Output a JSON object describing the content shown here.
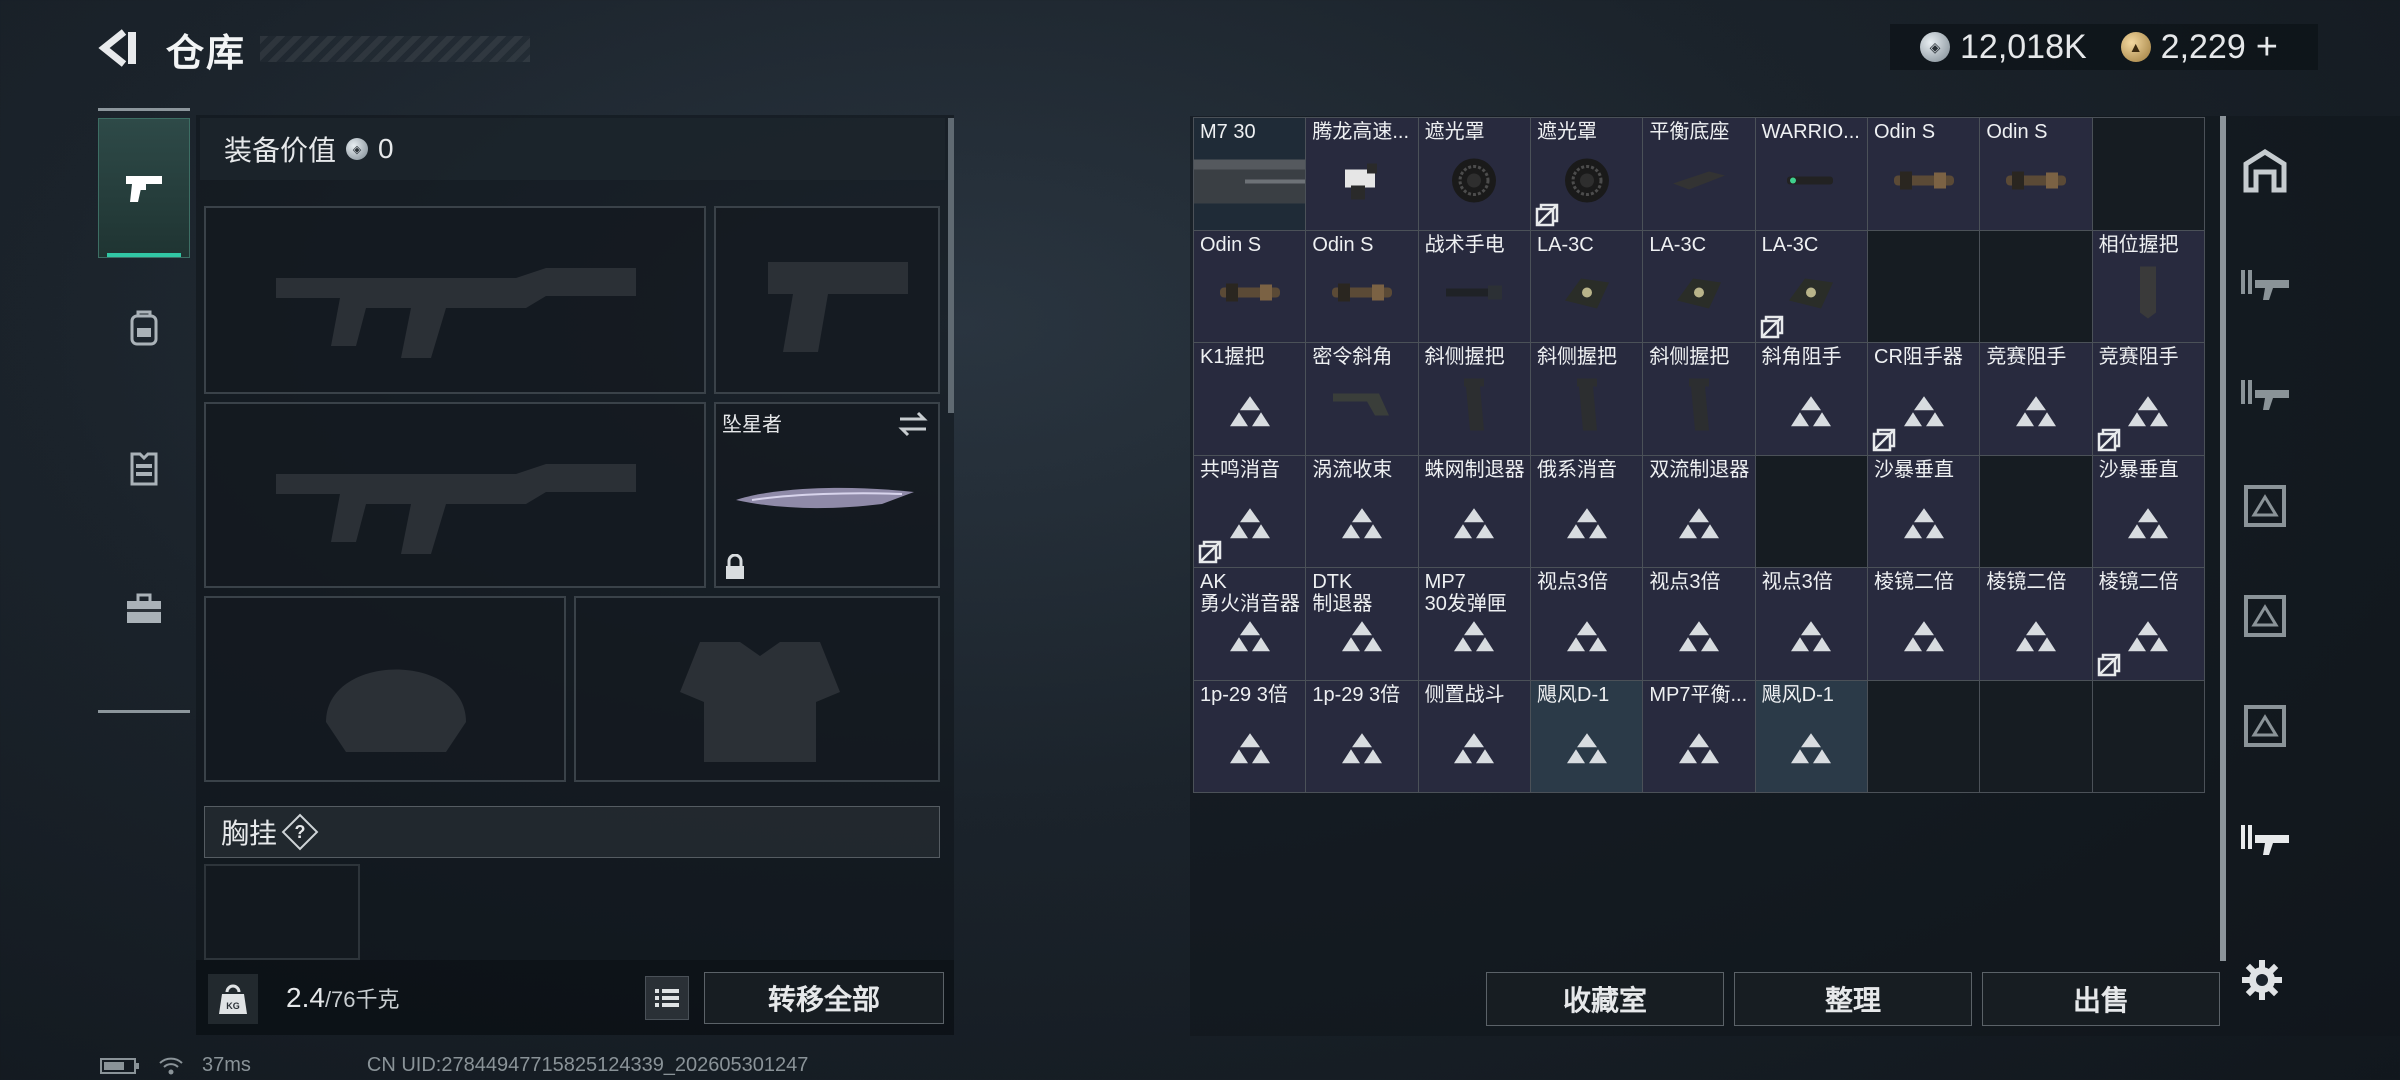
{
  "header": {
    "title": "仓库",
    "currency_silver": "12,018K",
    "currency_gold": "2,229",
    "currency_plus": "+"
  },
  "equipment": {
    "value_label": "装备价值",
    "value": "0",
    "melee_slot_label": "坠星者",
    "chest_label": "胸挂",
    "chest_help": "?"
  },
  "bottom_left": {
    "weight_current": "2.4",
    "weight_max": "/76千克",
    "weight_icon_text": "KG",
    "transfer_all": "转移全部"
  },
  "status": {
    "ping": "37ms",
    "uid": "CN UID:27844947715825124339_202605301247"
  },
  "grid": {
    "cells": [
      {
        "name": "M7 30",
        "kind": "mag",
        "style": "blue"
      },
      {
        "name": "腾龙高速...",
        "kind": "mount",
        "style": "normal"
      },
      {
        "name": "遮光罩",
        "kind": "hood",
        "style": "normal"
      },
      {
        "name": "遮光罩",
        "kind": "hood",
        "style": "normal",
        "badge": true
      },
      {
        "name": "平衡底座",
        "kind": "base",
        "style": "normal"
      },
      {
        "name": "WARRIO...",
        "kind": "laser",
        "style": "normal"
      },
      {
        "name": "Odin S",
        "kind": "scope",
        "style": "normal"
      },
      {
        "name": "Odin S",
        "kind": "scope",
        "style": "normal"
      },
      {
        "name": "",
        "kind": "none",
        "style": "empty"
      },
      {
        "name": "Odin S",
        "kind": "scope",
        "style": "normal"
      },
      {
        "name": "Odin S",
        "kind": "scope",
        "style": "normal"
      },
      {
        "name": "战术手电",
        "kind": "torch",
        "style": "normal"
      },
      {
        "name": "LA-3C",
        "kind": "la",
        "style": "normal"
      },
      {
        "name": "LA-3C",
        "kind": "la",
        "style": "normal"
      },
      {
        "name": "LA-3C",
        "kind": "la",
        "style": "normal",
        "badge": true
      },
      {
        "name": "",
        "kind": "none",
        "style": "empty"
      },
      {
        "name": "",
        "kind": "none",
        "style": "empty"
      },
      {
        "name": "相位握把",
        "kind": "grip",
        "style": "normal"
      },
      {
        "name": "K1握把",
        "kind": "tri",
        "style": "normal"
      },
      {
        "name": "密令斜角",
        "kind": "angled",
        "style": "normal"
      },
      {
        "name": "斜侧握把",
        "kind": "vgrip",
        "style": "normal"
      },
      {
        "name": "斜侧握把",
        "kind": "vgrip",
        "style": "normal"
      },
      {
        "name": "斜侧握把",
        "kind": "vgrip",
        "style": "normal"
      },
      {
        "name": "斜角阻手",
        "kind": "tri",
        "style": "normal"
      },
      {
        "name": "CR阻手器",
        "kind": "tri",
        "style": "normal",
        "badge": true
      },
      {
        "name": "竞赛阻手",
        "kind": "tri",
        "style": "normal"
      },
      {
        "name": "竞赛阻手",
        "kind": "tri",
        "style": "normal",
        "badge": true
      },
      {
        "name": "共鸣消音",
        "kind": "tri",
        "style": "normal",
        "badge": true
      },
      {
        "name": "涡流收束",
        "kind": "tri",
        "style": "normal"
      },
      {
        "name": "蛛网制退器",
        "kind": "tri",
        "style": "normal"
      },
      {
        "name": "俄系消音",
        "kind": "tri",
        "style": "normal"
      },
      {
        "name": "双流制退器",
        "kind": "tri",
        "style": "normal"
      },
      {
        "name": "",
        "kind": "none",
        "style": "empty"
      },
      {
        "name": "沙暴垂直",
        "kind": "tri",
        "style": "normal"
      },
      {
        "name": "",
        "kind": "none",
        "style": "empty"
      },
      {
        "name": "沙暴垂直",
        "kind": "tri",
        "style": "normal"
      },
      {
        "name": "AK\n勇火消音器",
        "kind": "tri",
        "style": "normal"
      },
      {
        "name": "DTK\n制退器",
        "kind": "tri",
        "style": "normal"
      },
      {
        "name": "MP7\n30发弹匣",
        "kind": "tri",
        "style": "normal"
      },
      {
        "name": "视点3倍",
        "kind": "tri",
        "style": "normal"
      },
      {
        "name": "视点3倍",
        "kind": "tri",
        "style": "normal"
      },
      {
        "name": "视点3倍",
        "kind": "tri",
        "style": "normal"
      },
      {
        "name": "棱镜二倍",
        "kind": "tri",
        "style": "normal"
      },
      {
        "name": "棱镜二倍",
        "kind": "tri",
        "style": "normal"
      },
      {
        "name": "棱镜二倍",
        "kind": "tri",
        "style": "normal",
        "badge": true
      },
      {
        "name": "1p-29 3倍",
        "kind": "tri",
        "style": "normal"
      },
      {
        "name": "1p-29 3倍",
        "kind": "tri",
        "style": "normal"
      },
      {
        "name": "侧置战斗",
        "kind": "tri",
        "style": "normal"
      },
      {
        "name": "飓风D-1",
        "kind": "tri",
        "style": "hl"
      },
      {
        "name": "MP7平衡...",
        "kind": "tri",
        "style": "normal"
      },
      {
        "name": "飓风D-1",
        "kind": "tri",
        "style": "hl"
      },
      {
        "name": "",
        "kind": "none",
        "style": "empty"
      },
      {
        "name": "",
        "kind": "none",
        "style": "empty"
      },
      {
        "name": "",
        "kind": "none",
        "style": "empty"
      }
    ]
  },
  "actions": {
    "collection": "收藏室",
    "sort": "整理",
    "sell": "出售"
  },
  "colors": {
    "accent_green": "#31c7a5",
    "cell_purple": "#282a3e",
    "cell_blue": "#1f2b37"
  },
  "icons": {
    "back": "back-arrow-icon",
    "rail": [
      "pistol-icon",
      "backpack-icon",
      "vest-icon",
      "toolbox-icon"
    ],
    "right_rail": [
      "storage-icon",
      "rifle-rack-icon",
      "rifle-rack-icon",
      "crate-icon",
      "crate-icon",
      "crate-icon",
      "rifle-rack-icon",
      "gear-icon"
    ]
  }
}
